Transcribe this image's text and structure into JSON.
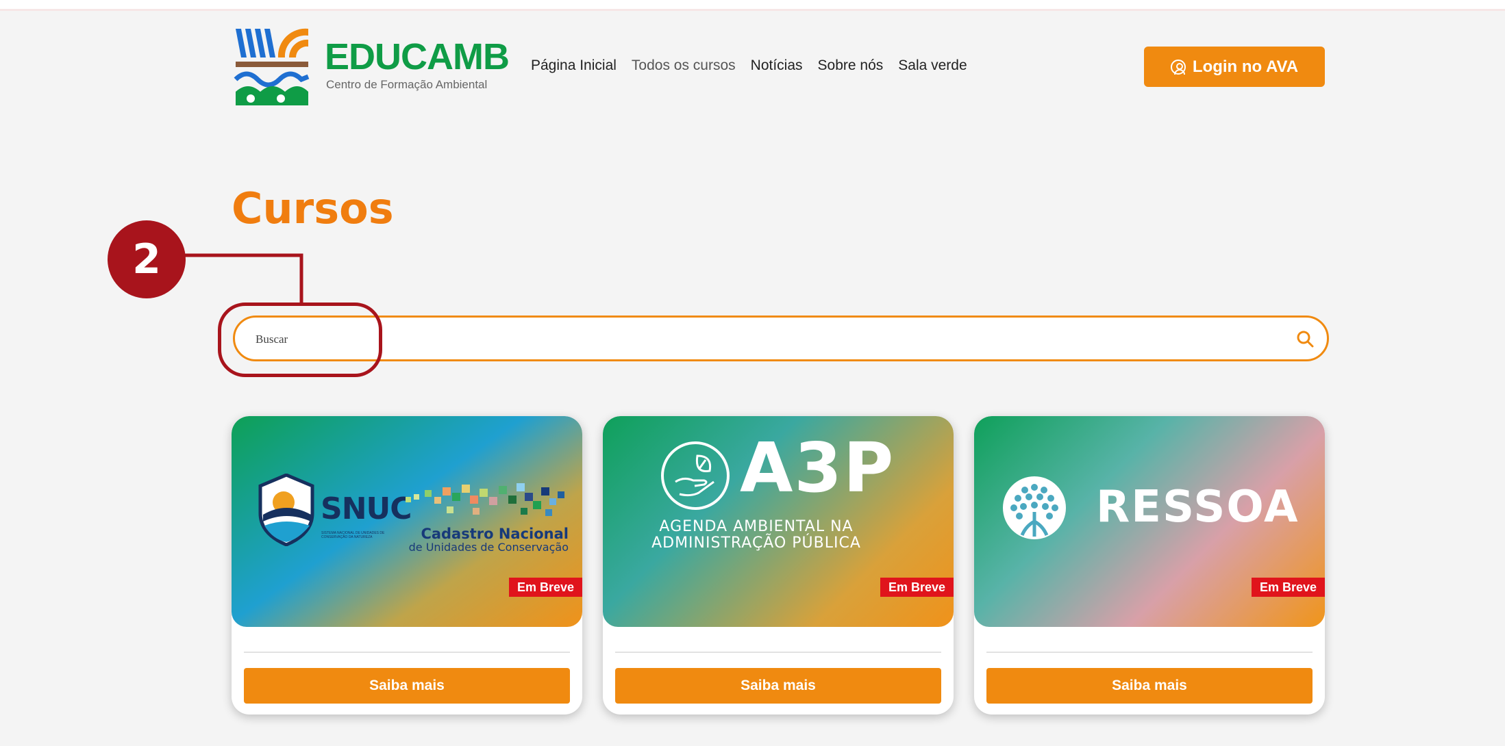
{
  "brand": {
    "name": "EDUCAMB",
    "subtitle": "Centro de Formação Ambiental"
  },
  "nav": {
    "items": [
      "Página Inicial",
      "Todos os cursos",
      "Notícias",
      "Sobre nós",
      "Sala verde"
    ]
  },
  "header": {
    "login_label": "Login no AVA"
  },
  "page": {
    "title": "Cursos"
  },
  "annotation": {
    "step": "2"
  },
  "search": {
    "placeholder": "Buscar"
  },
  "cards": [
    {
      "logo_text": "SNUC",
      "logo_small": "SISTEMA NACIONAL DE UNIDADES DE CONSERVAÇÃO DA NATUREZA",
      "secondary_title": "Cadastro Nacional",
      "secondary_sub": "de Unidades de Conservação",
      "badge": "Em Breve",
      "button": "Saiba mais"
    },
    {
      "logo_text": "A3P",
      "line1": "AGENDA AMBIENTAL NA",
      "line2": "ADMINISTRAÇÃO PÚBLICA",
      "badge": "Em Breve",
      "button": "Saiba mais"
    },
    {
      "logo_text": "RESSOA",
      "badge": "Em Breve",
      "button": "Saiba mais"
    }
  ],
  "colors": {
    "accent": "#f08a10",
    "brand_green": "#0f9c46",
    "annotation_red": "#a8141c",
    "badge_red": "#e0141c"
  }
}
